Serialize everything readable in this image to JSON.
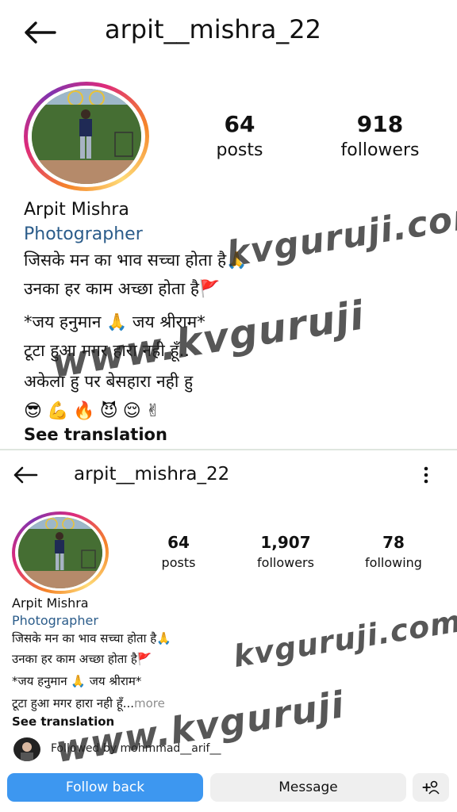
{
  "top": {
    "username": "arpit__mishra_22",
    "stats": [
      {
        "num": "64",
        "label": "posts"
      },
      {
        "num": "918",
        "label": "followers"
      }
    ],
    "name": "Arpit Mishra",
    "category": "Photographer",
    "bio": [
      "जिसके मन का भाव सच्चा होता है🙏",
      "उनका हर काम अच्छा होता है🚩",
      "*जय हनुमान 🙏 जय श्रीराम*",
      "टूटा हुआ मगर हारा नही हूँ..",
      "अकेला हु पर बेसहारा नही हु"
    ],
    "emojis": [
      "😎",
      "💪",
      "🔥",
      "😈",
      "😌",
      "✌"
    ],
    "see_translation": "See translation",
    "watermarks": [
      "kvguruji.com",
      "www.kvguruji"
    ]
  },
  "bottom": {
    "username": "arpit__mishra_22",
    "stats": [
      {
        "num": "64",
        "label": "posts"
      },
      {
        "num": "1,907",
        "label": "followers"
      },
      {
        "num": "78",
        "label": "following"
      }
    ],
    "name": "Arpit Mishra",
    "category": "Photographer",
    "bio": [
      "जिसके मन का भाव सच्चा होता है🙏",
      "उनका हर काम अच्छा होता है🚩",
      "*जय हनुमान 🙏 जय श्रीराम*",
      "टूटा हुआ मगर हारा नही हूँ..."
    ],
    "more": "more",
    "see_translation": "See translation",
    "followed_by": "Followed by mohmmad__arif__",
    "follow_back": "Follow back",
    "message": "Message",
    "add_user_glyph": "+",
    "watermarks": [
      "kvguruji.com",
      "www.kvguruji"
    ]
  },
  "colors": {
    "follow_back_bg": "#3d97f0",
    "message_bg": "#efefef",
    "category": "#2b5c8a",
    "watermark": "#282828"
  }
}
